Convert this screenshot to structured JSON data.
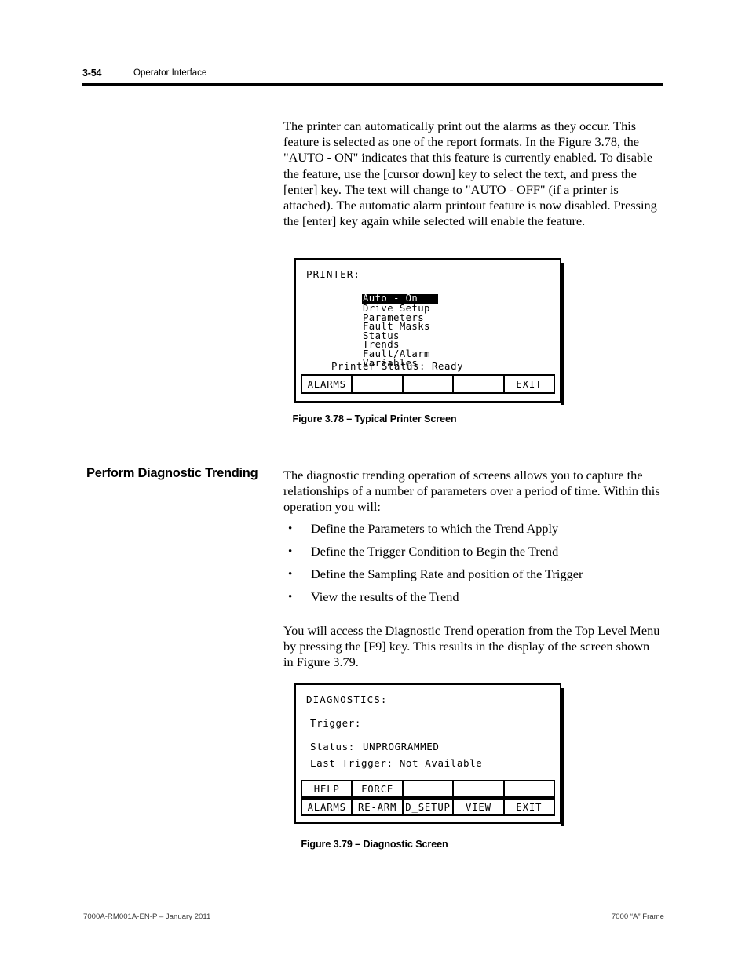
{
  "header": {
    "page_number": "3-54",
    "section": "Operator Interface"
  },
  "paragraphs": {
    "printer_intro": "The printer can automatically print out the alarms as they occur. This feature is selected as one of the report formats.  In the Figure 3.78, the \"AUTO - ON\" indicates that this feature is currently enabled.  To disable the feature, use the [cursor down] key to select the text, and press the [enter] key.  The text will change to \"AUTO - OFF\" (if a printer is attached).  The automatic alarm printout feature is now disabled.  Pressing the [enter] key again while selected will enable the feature.",
    "trending_intro": "The diagnostic trending operation of screens allows you to capture the relationships of a number of parameters over a period of time. Within this operation you will:",
    "trending_access": "You will access the Diagnostic Trend operation from the Top Level Menu by pressing the [F9] key. This results in the display of the screen shown in Figure 3.79."
  },
  "section_heading": "Perform Diagnostic Trending",
  "bullets": [
    "Define the Parameters to which the Trend Apply",
    "Define the Trigger Condition to Begin the Trend",
    "Define the Sampling Rate and position of the Trigger",
    "View the results of the Trend"
  ],
  "bullet_marker": "•",
  "figure_printer": {
    "title": "PRINTER:",
    "menu": [
      {
        "label": "Auto - On",
        "selected": true
      },
      {
        "label": "Drive Setup",
        "selected": false
      },
      {
        "label": "Parameters",
        "selected": false
      },
      {
        "label": "Fault Masks",
        "selected": false
      },
      {
        "label": "Status",
        "selected": false
      },
      {
        "label": "Trends",
        "selected": false
      },
      {
        "label": "Fault/Alarm",
        "selected": false
      },
      {
        "label": "Variables",
        "selected": false
      }
    ],
    "status_line": "Printer Status: Ready",
    "softkeys": [
      "ALARMS",
      "",
      "",
      "",
      "EXIT"
    ],
    "caption": "Figure 3.78 – Typical Printer Screen"
  },
  "figure_diagnostics": {
    "title": "DIAGNOSTICS:",
    "trigger_label": "Trigger:",
    "status_label": "Status:",
    "status_value": "UNPROGRAMMED",
    "last_trigger_line": "Last Trigger: Not Available",
    "softkeys_row1": [
      "HELP",
      "FORCE",
      "",
      "",
      ""
    ],
    "softkeys_row2": [
      "ALARMS",
      "RE-ARM",
      "D_SETUP",
      "VIEW",
      "EXIT"
    ],
    "caption": "Figure 3.79 – Diagnostic Screen"
  },
  "footer": {
    "left": "7000A-RM001A-EN-P –  January 2011",
    "right": "7000 “A” Frame"
  },
  "colors": {
    "ink": "#000000",
    "paper": "#ffffff"
  }
}
